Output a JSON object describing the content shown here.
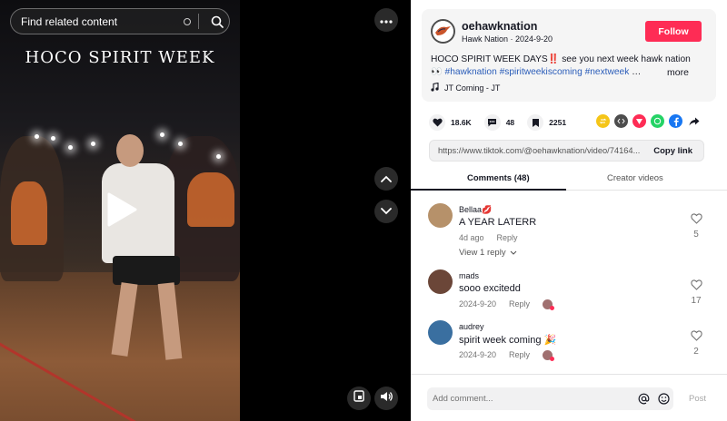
{
  "search": {
    "placeholder": "Find related content"
  },
  "video": {
    "overlay_title": "HOCO SPIRIT WEEK"
  },
  "author": {
    "username": "oehawknation",
    "subtitle": "Hawk Nation · 2024-9-20",
    "follow_label": "Follow"
  },
  "description": {
    "text_prefix": "HOCO SPIRIT WEEK DAYS‼️ see you next week hawk nation",
    "line2_emoji": "👀",
    "tags": [
      "#hawknation",
      "#spiritweekiscoming",
      "#nextweek"
    ],
    "ellipsis": "…",
    "more_label": "more",
    "music": "JT Coming - JT"
  },
  "stats": {
    "likes": "18.6K",
    "comments": "48",
    "saves": "2251"
  },
  "share_colors": [
    "#f5c518",
    "#4d4d4d",
    "#fe2c55",
    "#25d366",
    "#1877f2"
  ],
  "link": {
    "url": "https://www.tiktok.com/@oehawknation/video/74164...",
    "copy_label": "Copy link"
  },
  "tabs": {
    "comments": "Comments (48)",
    "creator": "Creator videos"
  },
  "comments": [
    {
      "name": "Bellaa",
      "name_emoji": "💋",
      "text": "A YEAR LATERR",
      "date": "4d ago",
      "reply_label": "Reply",
      "likes": "5",
      "avatar_color": "#b6916a"
    },
    {
      "name": "mads",
      "text": "sooo excitedd",
      "date": "2024-9-20",
      "reply_label": "Reply",
      "likes": "17",
      "avatar_color": "#6b4638"
    },
    {
      "name": "audrey",
      "text": "spirit week coming",
      "text_emoji": "🎉",
      "date": "2024-9-20",
      "reply_label": "Reply",
      "likes": "2",
      "avatar_color": "#3a6fa0"
    }
  ],
  "view_replies": "View 1 reply",
  "comment_bar": {
    "placeholder": "Add comment...",
    "post_label": "Post"
  }
}
